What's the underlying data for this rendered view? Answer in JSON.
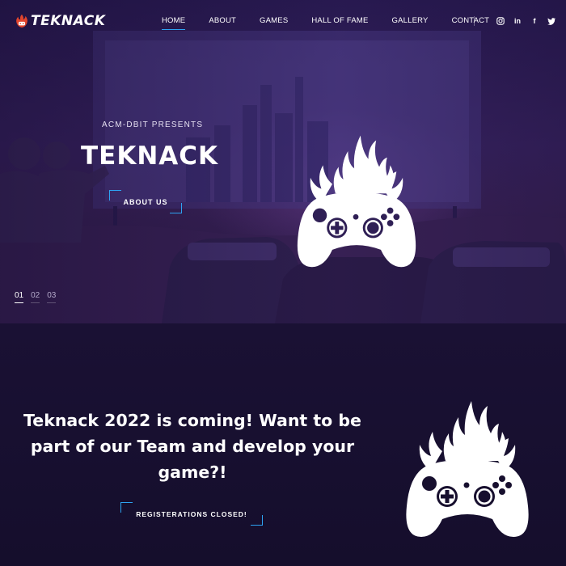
{
  "brand": {
    "name": "TEKNACK",
    "accent_color": "#2ea3f2",
    "logo_icon": "flame-icon"
  },
  "nav": {
    "links": [
      "HOME",
      "ABOUT",
      "GAMES",
      "HALL OF FAME",
      "GALLERY",
      "CONTACT"
    ],
    "active": "HOME",
    "socials": [
      {
        "icon": "instagram-icon",
        "glyph": "◎"
      },
      {
        "icon": "linkedin-icon",
        "glyph": "in"
      },
      {
        "icon": "facebook-icon",
        "glyph": "f"
      },
      {
        "icon": "twitter-icon",
        "glyph": "🐦"
      }
    ]
  },
  "hero": {
    "presents": "ACM-DBIT PRESENTS",
    "title": "TEKNACK",
    "button_label": "ABOUT US",
    "logo_icon": "flaming-gamepad-icon",
    "slides": [
      "01",
      "02",
      "03"
    ],
    "active_slide": "01"
  },
  "section2": {
    "heading": "Teknack 2022 is coming! Want to be part of our Team and develop your game?!",
    "button_label": "REGISTERATIONS CLOSED!",
    "logo_icon": "flaming-gamepad-icon"
  }
}
